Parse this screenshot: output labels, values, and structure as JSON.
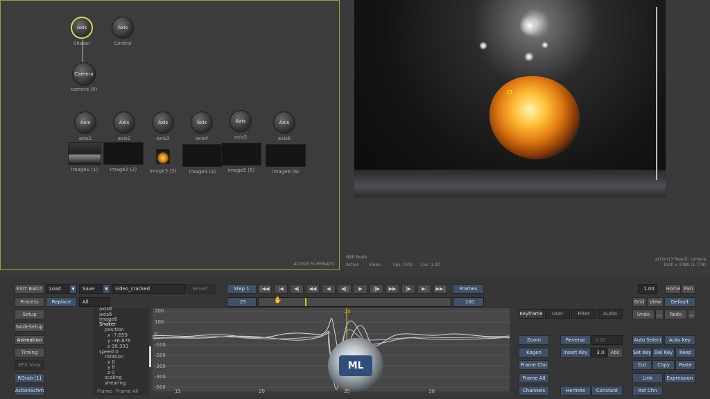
{
  "schematic": {
    "nodes": [
      {
        "label": "Axis",
        "name": "Shaker"
      },
      {
        "label": "Axis",
        "name": "Control"
      },
      {
        "label": "Camera",
        "name": "camera (0)"
      },
      {
        "label": "Axis",
        "name": "axis1"
      },
      {
        "label": "Axis",
        "name": "axis2"
      },
      {
        "label": "Axis",
        "name": "axis3"
      },
      {
        "label": "Axis",
        "name": "axis4"
      },
      {
        "label": "Axis",
        "name": "axis5"
      },
      {
        "label": "Axis",
        "name": "axis6"
      }
    ],
    "images": [
      "image1 (1)",
      "image2 (2)",
      "image3 (3)",
      "image4 (4)",
      "image5 (5)",
      "image6 (6)"
    ],
    "footer": "ACTION SCHEMATIC"
  },
  "viewer": {
    "left_info": [
      "NBR Node",
      "Active",
      "Video",
      "Fps: 0.00",
      "Cur: 1.00"
    ],
    "right_info": [
      "action13 Result: camera",
      "1920 x 1080 (1.778)"
    ]
  },
  "toolbar": {
    "exit_batch": "EXIT Batch",
    "load": "Load",
    "save": "Save",
    "setup_name": "video_cracked",
    "revert": "Revert",
    "process": "Process",
    "replace": "Replace",
    "all": "All",
    "left_buttons": [
      "Setup",
      "NodeSetup",
      "Animation",
      "Timing",
      "BFX View",
      "RGrab [1]",
      "ActionSchm"
    ],
    "step": "Step 1",
    "frames": "Frames",
    "start_frame": "25",
    "end_frame": "100",
    "transport_icons": [
      "|◀◀",
      "|◀",
      "◀|",
      "◀◀",
      "◀",
      "◀||",
      "▶",
      "||▶",
      "▶▶",
      "|▶",
      "▶|",
      "▶▶|"
    ],
    "right_top": {
      "zoom_value": "1.00",
      "home": "Home",
      "pan": "Pan",
      "grid": "Grid",
      "view": "View",
      "default": "Default",
      "undo": "Undo",
      "ellipsis": "...",
      "redo": "Redo"
    }
  },
  "curve_editor": {
    "tree": [
      "axis6",
      "axis6",
      "image6",
      "Shaker",
      "position",
      "x -7.659",
      "y -36.876",
      "z 30.391",
      "speed 0",
      "rotation",
      "x 0",
      "y 0",
      "z 0",
      "scaling",
      "shearing"
    ],
    "tree_footer": [
      "Frame",
      "Frame All"
    ],
    "y_ticks": [
      "200",
      "100",
      "0",
      "-100",
      "-200",
      "-300",
      "-400",
      "-500"
    ],
    "x_ticks": [
      "15",
      "20",
      "25",
      "30"
    ],
    "current_frame": "25"
  },
  "tabs": [
    "Keyframe",
    "User",
    "Filter",
    "Audio"
  ],
  "right_panel": {
    "col1": [
      "Zoom",
      "Kogen",
      "Frame Chn",
      "Frame All",
      "Channels"
    ],
    "col2": [
      "Reverse",
      "Insert Key",
      "Hermite"
    ],
    "key_value": "0.00",
    "key_count": "3.0",
    "abs": "Abs",
    "constant": "Constant",
    "col3": [
      "Auto Select",
      "Set Key",
      "Cut",
      "Link",
      "Rst Chn"
    ],
    "col4": [
      "Auto Key",
      "Del Key",
      "Copy",
      "Paste",
      "Keep",
      "Expression"
    ]
  },
  "logo_text": "ML"
}
